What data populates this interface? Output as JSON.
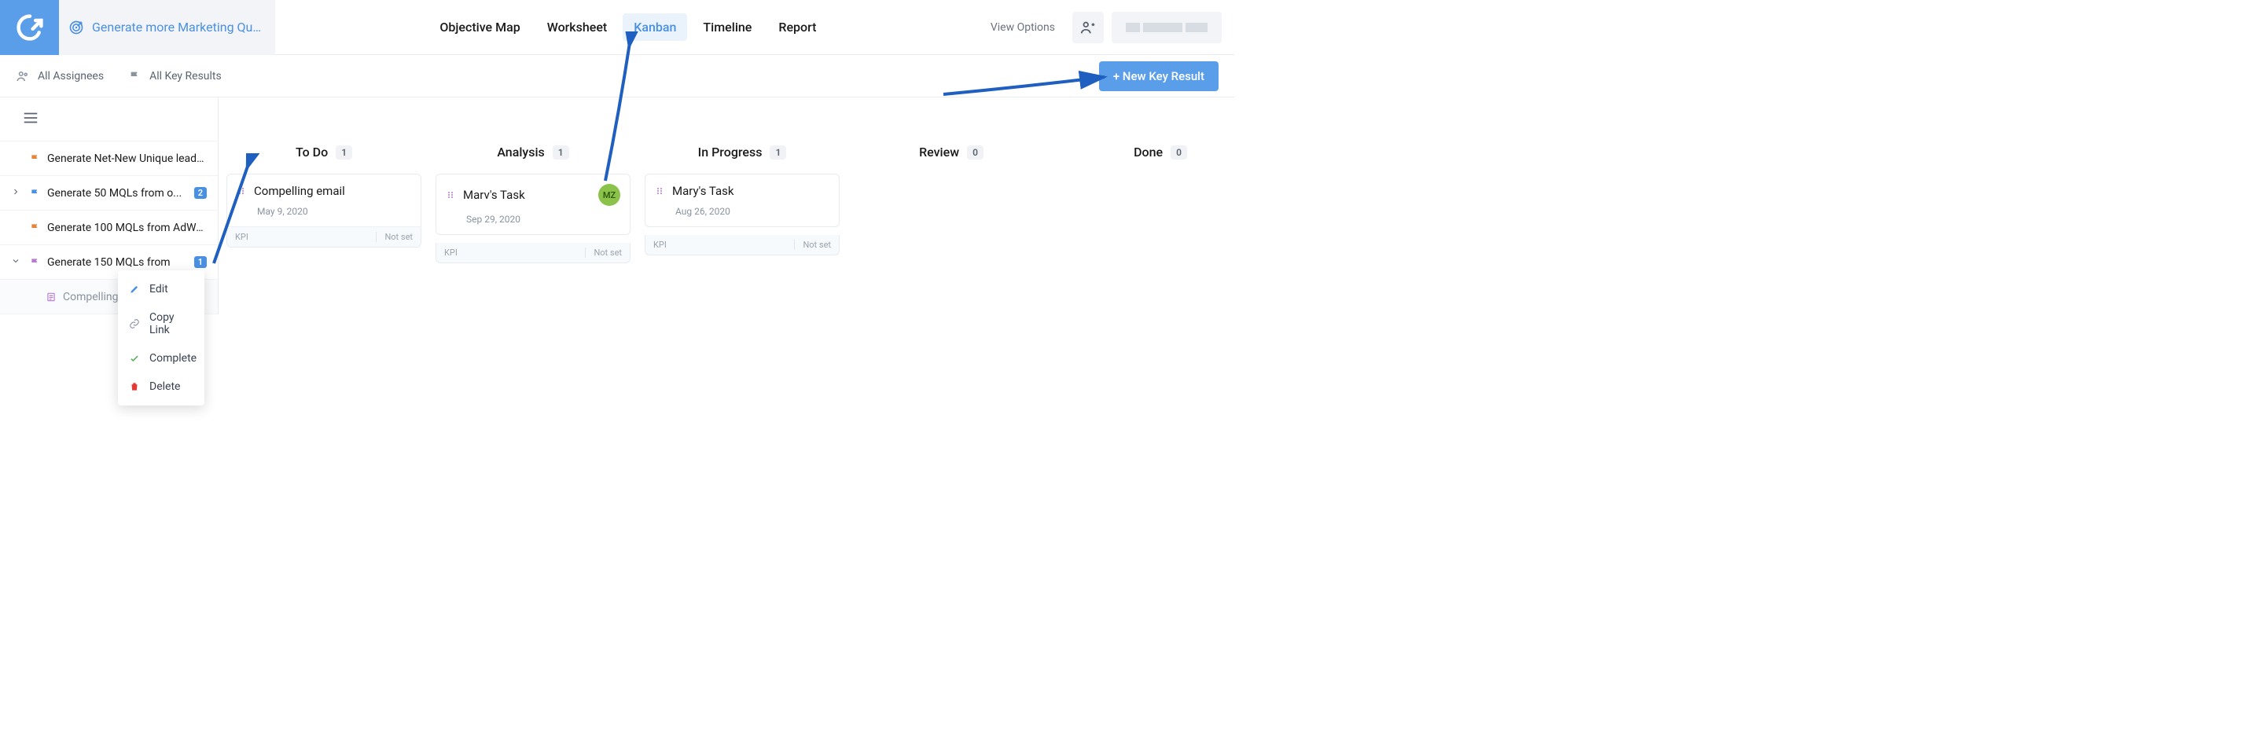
{
  "header": {
    "breadcrumb": "Generate more Marketing Qua...",
    "tabs": [
      "Objective Map",
      "Worksheet",
      "Kanban",
      "Timeline",
      "Report"
    ],
    "active_tab_index": 2,
    "view_options": "View Options"
  },
  "filters": {
    "assignees": "All Assignees",
    "key_results": "All Key Results"
  },
  "new_kr_button": "+ New Key Result",
  "sidebar": {
    "items": [
      {
        "label": "Generate Net-New Unique leads...",
        "flag_color": "#e8833a",
        "badge": null,
        "chevron": null
      },
      {
        "label": "Generate 50 MQLs from o...",
        "flag_color": "#4a90e2",
        "badge": "2",
        "chevron": "right"
      },
      {
        "label": "Generate 100 MQLs from AdWo...",
        "flag_color": "#e8833a",
        "badge": null,
        "chevron": null
      },
      {
        "label": "Generate 150 MQLs from",
        "flag_color": "#b77bd4",
        "badge": "1",
        "chevron": "down"
      }
    ],
    "child": {
      "label": "Compelling"
    }
  },
  "columns": [
    {
      "title": "To Do",
      "count": "1",
      "cards": [
        {
          "title": "Compelling email",
          "date": "May 9, 2020",
          "avatar": null,
          "kpi": "KPI",
          "status": "Not set",
          "show_footer_inline": true
        }
      ]
    },
    {
      "title": "Analysis",
      "count": "1",
      "cards": [
        {
          "title": "Marv's Task",
          "date": "Sep 29, 2020",
          "avatar": "MZ",
          "kpi": "KPI",
          "status": "Not set",
          "show_footer_inline": false
        }
      ]
    },
    {
      "title": "In Progress",
      "count": "1",
      "cards": [
        {
          "title": "Mary's Task",
          "date": "Aug 26, 2020",
          "avatar": null,
          "kpi": "KPI",
          "status": "Not set",
          "show_footer_inline": false
        }
      ]
    },
    {
      "title": "Review",
      "count": "0",
      "cards": []
    },
    {
      "title": "Done",
      "count": "0",
      "cards": []
    }
  ],
  "context_menu": {
    "edit": "Edit",
    "copy_link": "Copy Link",
    "complete": "Complete",
    "delete": "Delete"
  }
}
